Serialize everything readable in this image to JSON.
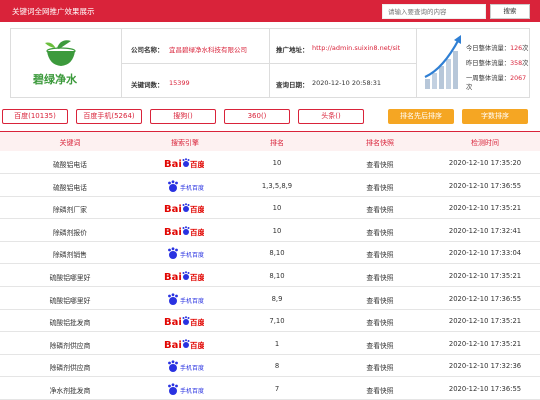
{
  "header": {
    "title": "关键词全网推广效果展示",
    "search_placeholder": "请输入要查询的内容",
    "search_button": "搜索"
  },
  "company": {
    "logo_text": "碧绿净水",
    "name_label": "公司名称：",
    "name": "宜昌碧绿净水科技有限公司",
    "site_label": "推广地址：",
    "site": "http://admin.suixin8.net/sit",
    "keywords_label": "关键词数：",
    "keywords_count": "15399",
    "date_label": "查询日期：",
    "date": "2020-12-10 20:58:31"
  },
  "traffic": {
    "today_label": "今日整体流量：",
    "today_value": "126",
    "yesterday_label": "昨日整体流量：",
    "yesterday_value": "358",
    "week_label": "一周整体流量：",
    "week_value": "2067",
    "unit": "次"
  },
  "tabs": {
    "baidu": "百度(10135)",
    "baidu_mobile": "百度手机(5264)",
    "sogou": "搜狗()",
    "s360": "360()",
    "toutiao": "头条()",
    "sort_rank": "排名先后排序",
    "sort_chars": "字数排序"
  },
  "table": {
    "headers": [
      "关键词",
      "搜索引擎",
      "排名",
      "排名快照",
      "检测时间"
    ],
    "rows": [
      {
        "keyword": "硫酸铝电话",
        "engine": "pc",
        "rank": "10",
        "snapshot": "查看快照",
        "time": "2020-12-10 17:35:20"
      },
      {
        "keyword": "硫酸铝电话",
        "engine": "mobile",
        "rank": "1,3,5,8,9",
        "snapshot": "查看快照",
        "time": "2020-12-10 17:36:55"
      },
      {
        "keyword": "除磷剂厂家",
        "engine": "pc",
        "rank": "10",
        "snapshot": "查看快照",
        "time": "2020-12-10 17:35:21"
      },
      {
        "keyword": "除磷剂报价",
        "engine": "pc",
        "rank": "10",
        "snapshot": "查看快照",
        "time": "2020-12-10 17:32:41"
      },
      {
        "keyword": "除磷剂销售",
        "engine": "mobile",
        "rank": "8,10",
        "snapshot": "查看快照",
        "time": "2020-12-10 17:33:04"
      },
      {
        "keyword": "硫酸铝哪里好",
        "engine": "pc",
        "rank": "8,10",
        "snapshot": "查看快照",
        "time": "2020-12-10 17:35:21"
      },
      {
        "keyword": "硫酸铝哪里好",
        "engine": "mobile",
        "rank": "8,9",
        "snapshot": "查看快照",
        "time": "2020-12-10 17:36:55"
      },
      {
        "keyword": "硫酸铝批发商",
        "engine": "pc",
        "rank": "7,10",
        "snapshot": "查看快照",
        "time": "2020-12-10 17:35:21"
      },
      {
        "keyword": "除磷剂供应商",
        "engine": "pc",
        "rank": "1",
        "snapshot": "查看快照",
        "time": "2020-12-10 17:35:21"
      },
      {
        "keyword": "除磷剂供应商",
        "engine": "mobile",
        "rank": "8",
        "snapshot": "查看快照",
        "time": "2020-12-10 17:32:36"
      },
      {
        "keyword": "净水剂批发商",
        "engine": "mobile",
        "rank": "7",
        "snapshot": "查看快照",
        "time": "2020-12-10 17:36:55"
      }
    ]
  },
  "engine_labels": {
    "pc_text": "Bai",
    "pc_text2": "百度",
    "mobile_text": "手机百度"
  },
  "colors": {
    "brand_red": "#d9233a",
    "sort_orange": "#f5a623",
    "baidu_blue": "#2932e1",
    "logo_green": "#3c9a3c"
  }
}
